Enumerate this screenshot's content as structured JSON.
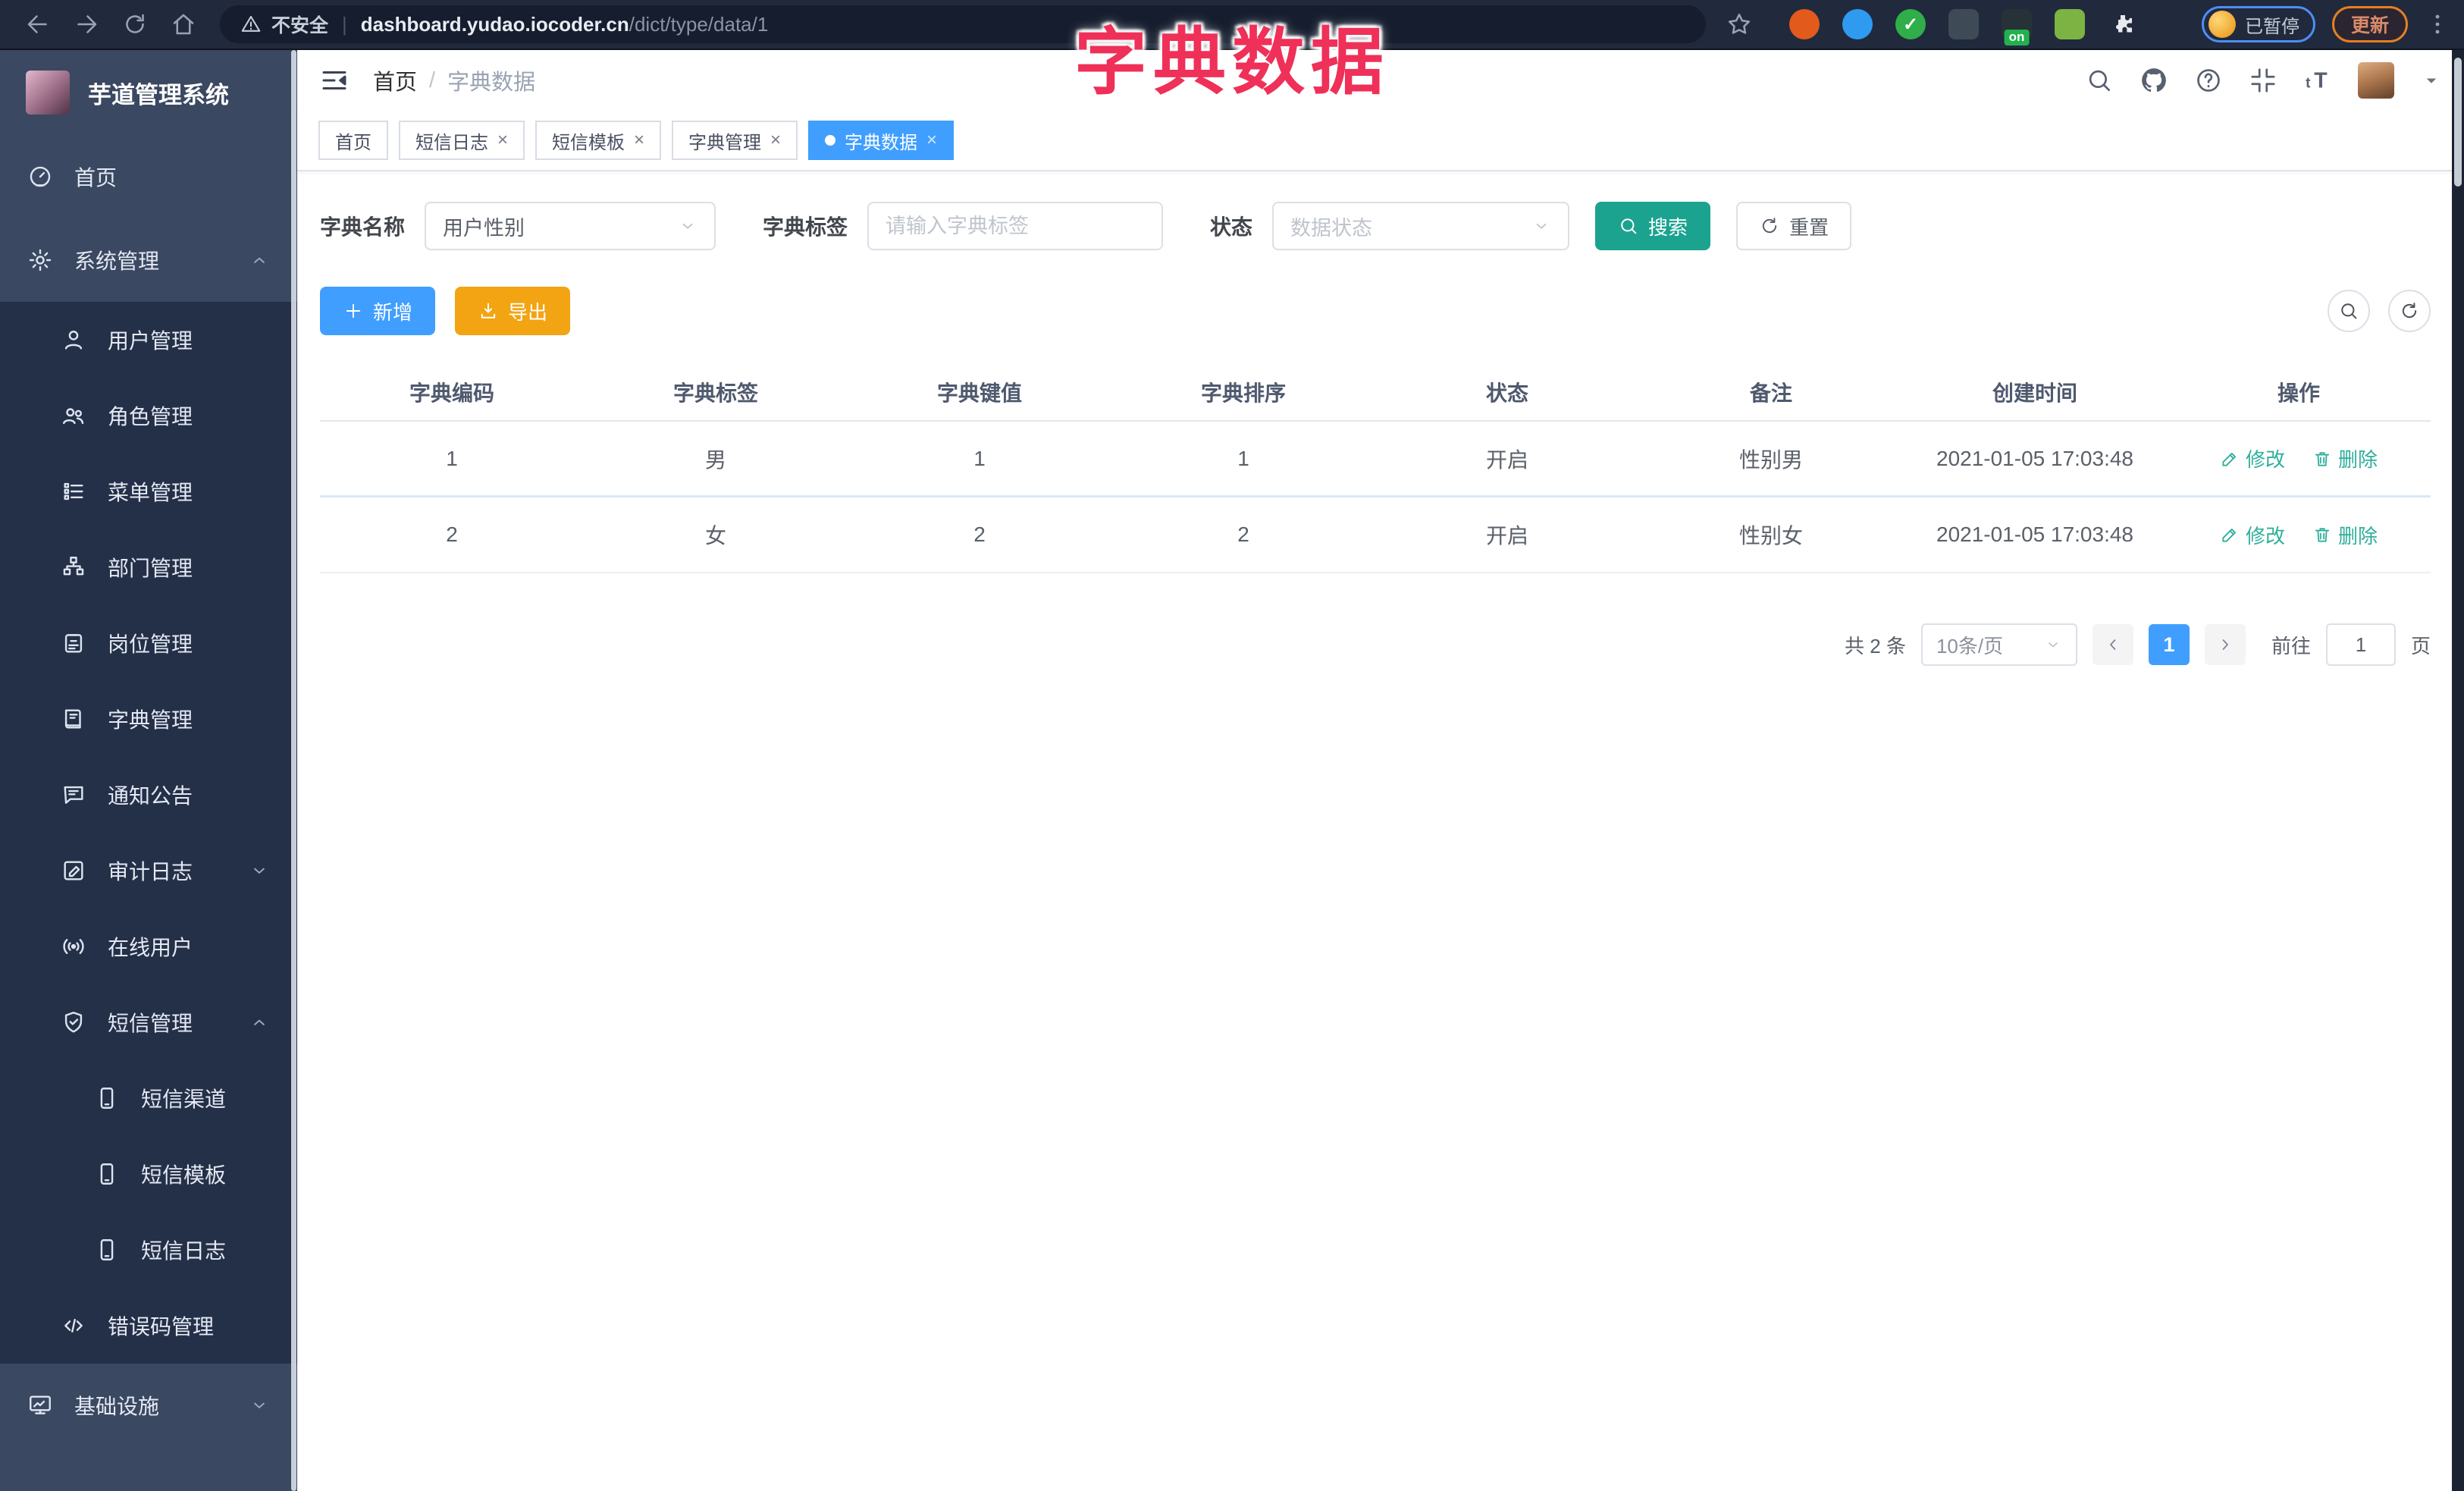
{
  "browser": {
    "security_label": "不安全",
    "url_host": "dashboard.yudao.iocoder.cn",
    "url_path": "/dict/type/data/1",
    "paused_label": "已暂停",
    "update_label": "更新",
    "extensions": [
      {
        "icon": "orange-ring-extension-icon",
        "color": "#E25A1C",
        "shape": "circle"
      },
      {
        "icon": "blue-gem-extension-icon",
        "color": "#2E9BF0",
        "shape": "circle"
      },
      {
        "icon": "green-check-extension-icon",
        "color": "#2FAE4A",
        "shape": "circle",
        "glyph": "✓"
      },
      {
        "icon": "toggles-extension-icon",
        "color": "#3E4A56",
        "shape": "square"
      },
      {
        "icon": "proxy-extension-icon",
        "color": "#263238",
        "shape": "square",
        "badge": "on"
      },
      {
        "icon": "leaf-extension-icon",
        "color": "#7CB342",
        "shape": "square"
      },
      {
        "icon": "puzzle-extension-icon",
        "color": "#E8EAED",
        "shape": "circle"
      }
    ]
  },
  "overlay_title": "字典数据",
  "sidebar": {
    "logo_title": "芋道管理系统",
    "items": [
      {
        "label": "首页",
        "icon": "dashboard-icon",
        "level": 0
      },
      {
        "label": "系统管理",
        "icon": "gear-icon",
        "level": 0,
        "chevron": "up"
      },
      {
        "label": "用户管理",
        "icon": "user-icon",
        "level": 1
      },
      {
        "label": "角色管理",
        "icon": "users-icon",
        "level": 1
      },
      {
        "label": "菜单管理",
        "icon": "menu-list-icon",
        "level": 1
      },
      {
        "label": "部门管理",
        "icon": "org-tree-icon",
        "level": 1
      },
      {
        "label": "岗位管理",
        "icon": "badge-icon",
        "level": 1
      },
      {
        "label": "字典管理",
        "icon": "dictionary-icon",
        "level": 1
      },
      {
        "label": "通知公告",
        "icon": "announcement-icon",
        "level": 1
      },
      {
        "label": "审计日志",
        "icon": "audit-log-icon",
        "level": 1,
        "chevron": "down"
      },
      {
        "label": "在线用户",
        "icon": "online-users-icon",
        "level": 1
      },
      {
        "label": "短信管理",
        "icon": "shield-check-icon",
        "level": 1,
        "chevron": "up"
      },
      {
        "label": "短信渠道",
        "icon": "phone-icon",
        "level": 2
      },
      {
        "label": "短信模板",
        "icon": "phone-icon",
        "level": 2
      },
      {
        "label": "短信日志",
        "icon": "phone-icon",
        "level": 2
      },
      {
        "label": "错误码管理",
        "icon": "code-icon",
        "level": 1
      },
      {
        "label": "基础设施",
        "icon": "infrastructure-icon",
        "level": 0,
        "chevron": "down"
      }
    ]
  },
  "header": {
    "breadcrumb_home": "首页",
    "breadcrumb_separator": "/",
    "breadcrumb_current": "字典数据"
  },
  "tabs": [
    {
      "label": "首页",
      "active": false,
      "closable": false
    },
    {
      "label": "短信日志",
      "active": false,
      "closable": true
    },
    {
      "label": "短信模板",
      "active": false,
      "closable": true
    },
    {
      "label": "字典管理",
      "active": false,
      "closable": true
    },
    {
      "label": "字典数据",
      "active": true,
      "closable": true
    }
  ],
  "filters": {
    "dict_name_label": "字典名称",
    "dict_name_value": "用户性别",
    "dict_label_label": "字典标签",
    "dict_label_placeholder": "请输入字典标签",
    "status_label": "状态",
    "status_placeholder": "数据状态",
    "search_label": "搜索",
    "reset_label": "重置"
  },
  "toolbar": {
    "add_label": "新增",
    "export_label": "导出"
  },
  "table": {
    "headers": [
      "字典编码",
      "字典标签",
      "字典键值",
      "字典排序",
      "状态",
      "备注",
      "创建时间",
      "操作"
    ],
    "rows": [
      {
        "code": "1",
        "label": "男",
        "value": "1",
        "sort": "1",
        "status": "开启",
        "remark": "性别男",
        "created": "2021-01-05 17:03:48"
      },
      {
        "code": "2",
        "label": "女",
        "value": "2",
        "sort": "2",
        "status": "开启",
        "remark": "性别女",
        "created": "2021-01-05 17:03:48"
      }
    ],
    "edit_label": "修改",
    "delete_label": "删除"
  },
  "pagination": {
    "total_text": "共 2 条",
    "page_size_text": "10条/页",
    "current_page": "1",
    "goto_label": "前往",
    "goto_value": "1",
    "page_unit": "页"
  },
  "colors": {
    "primary": "#409EFF",
    "search_teal": "#1BA390",
    "export_orange": "#F2A412",
    "action_link": "#2FAF9B",
    "overlay_pink": "#EF3058",
    "sidebar_bg": "#3A4861",
    "sidebar_submenu_bg": "#243048"
  }
}
